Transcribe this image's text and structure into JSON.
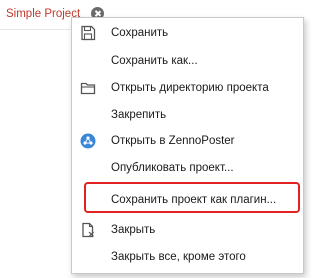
{
  "tab": {
    "title": "Simple Project",
    "close_icon": "close-circle-icon"
  },
  "colors": {
    "tab_title": "#c0392b",
    "zennoposter_icon": "#3a86d8",
    "highlight_border": "#e02222"
  },
  "menu": {
    "items": [
      {
        "label": "Сохранить",
        "icon": "save-disk-icon"
      },
      {
        "label": "Сохранить как..."
      },
      {
        "label": "Открыть директорию проекта",
        "icon": "folder-icon"
      },
      {
        "label": "Закрепить"
      },
      {
        "label": "Открыть в ZennoPoster",
        "icon": "zennoposter-icon"
      },
      {
        "label": "Опубликовать проект..."
      },
      {
        "label": "Сохранить проект как плагин...",
        "highlighted": true
      },
      {
        "label": "Закрыть",
        "icon": "close-document-icon"
      },
      {
        "label": "Закрыть все, кроме этого"
      }
    ]
  }
}
